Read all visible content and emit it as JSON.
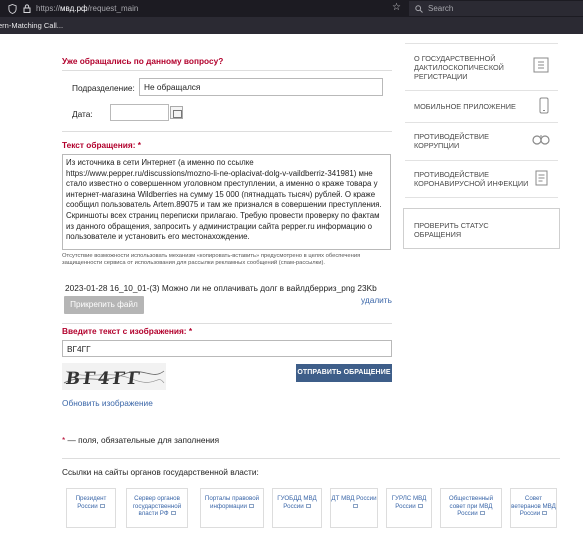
{
  "browser": {
    "url_prefix": "https://",
    "url_host": "мвд.рф",
    "url_path": "/request_main",
    "search_placeholder": "Search",
    "bookmark": "ern-Matching Call..."
  },
  "form": {
    "previous_title": "Уже обращались по данному вопросу?",
    "department_label": "Подразделение:",
    "department_value": "Не обращался",
    "date_label": "Дата:",
    "date_value": "",
    "text_title": "Текст обращения: *",
    "text_value": "Из источника в сети Интернет (а именно по ссылке https://www.pepper.ru/discussions/mozno-li-ne-oplacivat-dolg-v-vaildberriz-341981) мне стало известно о совершенном уголовном преступлении, а именно о краже товара у интернет-магазина Wildberries на сумму 15 000 (пятнадцать тысяч) рублей. О краже сообщил пользователь Artem.89075 и там же признался в совершении преступления. Скриншоты всех страниц переписки прилагаю. Требую провести проверку по фактам из данного обращения, запросить у администрации сайта pepper.ru информацию о пользователе и установить его местонахождение.",
    "copy_note": "Отсутствие возможности использовать механизм «копировать-вставить» предусмотрено в целях обеспечения защищенности сервиса от использования для рассылки рекламных сообщений (спам-рассылки).",
    "attached_file": "2023-01-28 16_10_01-(3) Можно ли не оплачивать долг в вайлдберриз_png 23Kb",
    "delete_label": "удалить",
    "attach_button": "Прикрепить файл",
    "captcha_title": "Введите текст с изображения: *",
    "captcha_value": "ВГ4ГГ",
    "captcha_image_text": "ВГ4ГГ",
    "submit_button": "ОТПРАВИТЬ ОБРАЩЕНИЕ",
    "refresh_link": "Обновить изображение",
    "required_note": "— поля, обязательные для заполнения",
    "required_star": "*"
  },
  "sidebar": {
    "items": [
      {
        "label": "О ГОСУДАРСТВЕННОЙ ДАКТИЛОСКОПИЧЕСКОЙ РЕГИСТРАЦИИ",
        "icon": "fingerprint-icon"
      },
      {
        "label": "МОБИЛЬНОЕ ПРИЛОЖЕНИЕ",
        "icon": "phone-icon"
      },
      {
        "label": "ПРОТИВОДЕЙСТВИЕ КОРРУПЦИИ",
        "icon": "handcuffs-icon"
      },
      {
        "label": "ПРОТИВОДЕЙСТВИЕ КОРОНАВИРУСНОЙ ИНФЕКЦИИ",
        "icon": "document-icon"
      }
    ],
    "status_check": "ПРОВЕРИТЬ СТАТУС ОБРАЩЕНИЯ"
  },
  "footer": {
    "links_title": "Ссылки на сайты органов государственной власти:",
    "links": [
      "Президент России",
      "Сервер органов государственной власти РФ",
      "Порталы правовой информации",
      "ГУОБДД МВД России",
      "ДТ МВД России",
      "ГУРЛС МВД России",
      "Общественный совет при МВД России",
      "Совет ветеранов МВД России"
    ]
  },
  "colors": {
    "accent_red": "#b2002c",
    "link_blue": "#3a66a8",
    "submit_blue": "#3e5e89",
    "browser_dark": "#1c1b22"
  }
}
